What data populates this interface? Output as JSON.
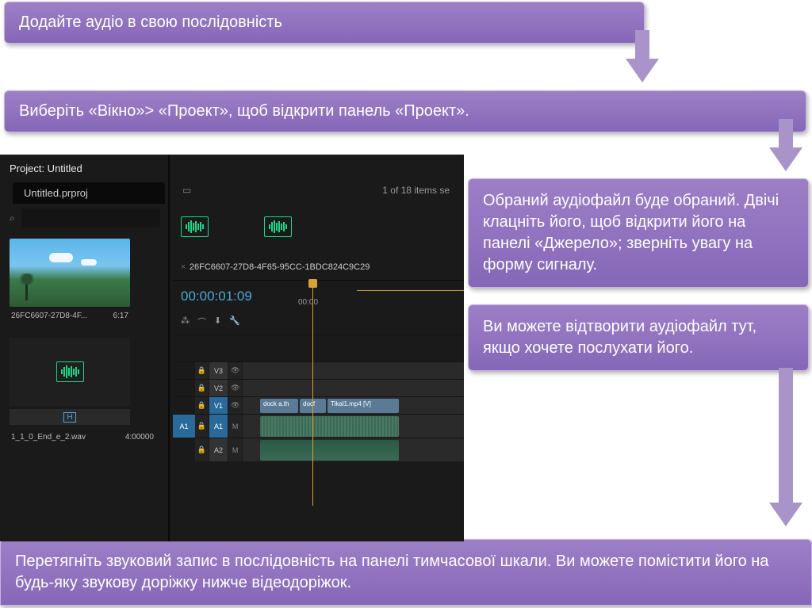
{
  "steps": {
    "s1": "Додайте аудіо в свою послідовність",
    "s2": "Виберіть «Вікно»> «Проект», щоб відкрити панель «Проект».",
    "s3": "Обраний аудіофайл буде обраний. Двічі клацніть його, щоб відкрити його на панелі «Джерело»; зверніть увагу на форму сигналу.",
    "s4": "Ви можете відтворити аудіофайл тут, якщо хочете послухати його.",
    "s5": "Перетягніть звуковий запис в послідовність на панелі тимчасової шкали. Ви можете помістити його на будь-яку звукову доріжку нижче відеодоріжок."
  },
  "premiere": {
    "project_label": "Project: Untitled",
    "project_file": "Untitled.prproj",
    "search_placeholder": "",
    "item_count": "1 of 18 items se",
    "bin1": {
      "name": "26FC6607-27D8-4F...",
      "dur": "6:17"
    },
    "bin2": {
      "name": "1_1_0_End_e_2.wav",
      "dur": "4:00000"
    },
    "sequence": {
      "name": "26FC6607-27D8-4F65-95CC-1BDC824C9C29",
      "timecode": "00:00:01:09",
      "ruler_marks": [
        "00:00"
      ],
      "tracks": {
        "v3": "V3",
        "v2": "V2",
        "v1": "V1",
        "a1": "A1",
        "a2": "A2"
      },
      "clips": {
        "c1": "dock a.th",
        "c2": "docf",
        "c3": "Tikal1.mp4 [V]"
      }
    }
  }
}
